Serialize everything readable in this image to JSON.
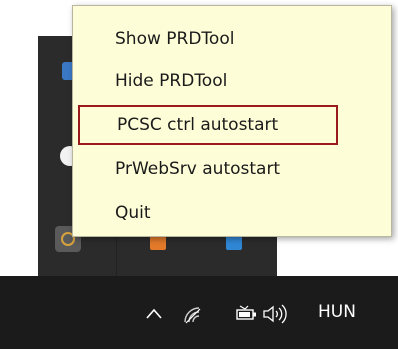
{
  "context_menu": {
    "items": [
      {
        "label": "Show PRDTool"
      },
      {
        "label": "Hide PRDTool"
      },
      {
        "label": "PCSC ctrl autostart",
        "selected": true
      },
      {
        "label": "PrWebSrv autostart"
      },
      {
        "label": "Quit"
      }
    ]
  },
  "taskbar": {
    "language": "HUN",
    "icons": [
      "chevron-up-icon",
      "wifi-icon",
      "battery-icon",
      "volume-icon"
    ]
  },
  "colors": {
    "menu_background": "#fdfdd8",
    "selection_border": "#9a1b1b",
    "taskbar": "#1b1b1b",
    "tray_panel": "#2b2b2b"
  }
}
